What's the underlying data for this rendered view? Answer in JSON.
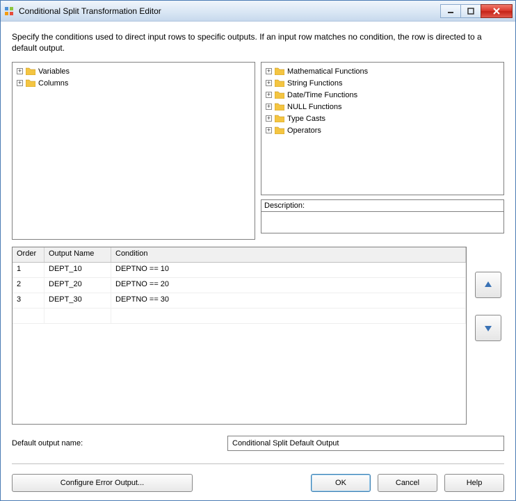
{
  "window": {
    "title": "Conditional Split Transformation Editor"
  },
  "instructions": "Specify the conditions used to direct input rows to specific outputs. If an input row matches no condition, the row is directed to a default output.",
  "left_tree": {
    "items": [
      "Variables",
      "Columns"
    ]
  },
  "right_tree": {
    "items": [
      "Mathematical Functions",
      "String Functions",
      "Date/Time Functions",
      "NULL Functions",
      "Type Casts",
      "Operators"
    ]
  },
  "description": {
    "label": "Description:",
    "value": ""
  },
  "grid": {
    "headers": {
      "order": "Order",
      "output_name": "Output Name",
      "condition": "Condition"
    },
    "rows": [
      {
        "order": "1",
        "name": "DEPT_10",
        "cond": "DEPTNO == 10"
      },
      {
        "order": "2",
        "name": "DEPT_20",
        "cond": "DEPTNO == 20"
      },
      {
        "order": "3",
        "name": "DEPT_30",
        "cond": "DEPTNO == 30"
      }
    ]
  },
  "default_output": {
    "label": "Default output name:",
    "value": "Conditional Split Default Output"
  },
  "buttons": {
    "configure_error": "Configure Error Output...",
    "ok": "OK",
    "cancel": "Cancel",
    "help": "Help"
  }
}
